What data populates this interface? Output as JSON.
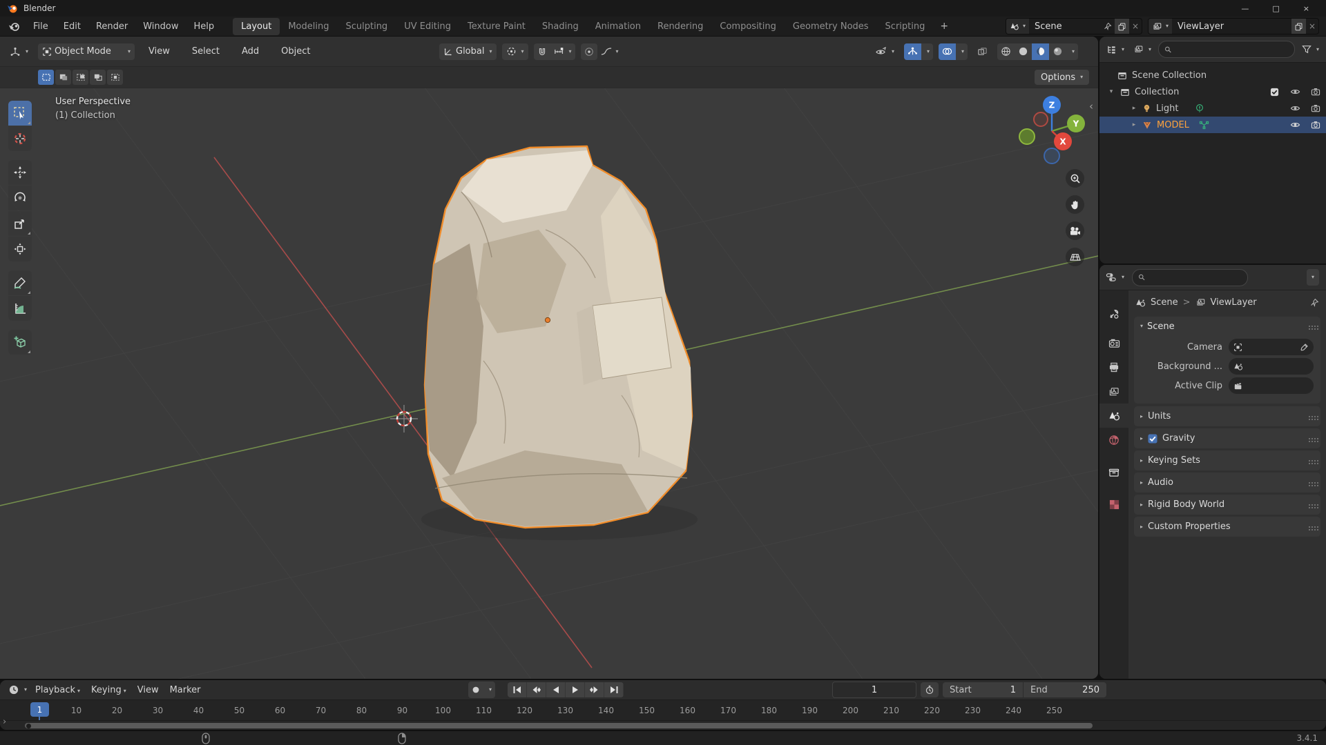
{
  "window": {
    "title": "Blender"
  },
  "glyphs": {
    "chevron_down": "▾",
    "chevron_right": "▸",
    "chevron_open": "▾",
    "collapse_left": "‹",
    "expand_right": "›",
    "gt": ">",
    "minimize": "—",
    "maximize": "□",
    "close": "×",
    "plus": "+"
  },
  "topbar": {
    "menus": [
      "File",
      "Edit",
      "Render",
      "Window",
      "Help"
    ],
    "tabs": [
      "Layout",
      "Modeling",
      "Sculpting",
      "UV Editing",
      "Texture Paint",
      "Shading",
      "Animation",
      "Rendering",
      "Compositing",
      "Geometry Nodes",
      "Scripting"
    ],
    "active_tab": "Layout",
    "scene": {
      "value": "Scene"
    },
    "viewlayer": {
      "value": "ViewLayer"
    }
  },
  "viewport": {
    "mode": "Object Mode",
    "menus": [
      "View",
      "Select",
      "Add",
      "Object"
    ],
    "orientation": "Global",
    "options_label": "Options",
    "overlay_line1": "User Perspective",
    "overlay_line2": "(1) Collection",
    "gizmo": {
      "x": "X",
      "y": "Y",
      "z": "Z"
    }
  },
  "outliner": {
    "rows": [
      {
        "label": "Scene Collection"
      },
      {
        "label": "Collection"
      },
      {
        "label": "Light"
      },
      {
        "label": "MODEL"
      }
    ]
  },
  "properties": {
    "breadcrumb": {
      "scene": "Scene",
      "viewlayer": "ViewLayer"
    },
    "scene_panel": {
      "title": "Scene",
      "camera_label": "Camera",
      "background_label": "Background ...",
      "active_clip_label": "Active Clip"
    },
    "panels": [
      "Units",
      "Gravity",
      "Keying Sets",
      "Audio",
      "Rigid Body World",
      "Custom Properties"
    ]
  },
  "timeline": {
    "menus": [
      "Playback",
      "Keying",
      "View",
      "Marker"
    ],
    "current_frame": "1",
    "start_label": "Start",
    "start_value": "1",
    "end_label": "End",
    "end_value": "250",
    "ticks": [
      "10",
      "20",
      "30",
      "40",
      "50",
      "60",
      "70",
      "80",
      "90",
      "100",
      "110",
      "120",
      "130",
      "140",
      "150",
      "160",
      "170",
      "180",
      "190",
      "200",
      "210",
      "220",
      "230",
      "240",
      "250"
    ]
  },
  "statusbar": {
    "version": "3.4.1"
  },
  "colors": {
    "accent": "#4772b3",
    "selection_row": "#334970",
    "active_object_text": "#ffa33c",
    "selection_outline": "#f08c2a",
    "axis_x": "#c4504e",
    "axis_y": "#7d9c4f",
    "axis_z": "#3d7fe0"
  }
}
